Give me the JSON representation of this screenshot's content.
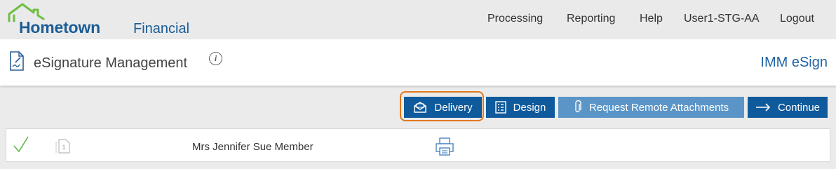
{
  "brand": {
    "name_part1": "Hometown",
    "name_part2": "Financial",
    "logo_color": "#1a5d96",
    "roof_color": "#6fbe44"
  },
  "nav": {
    "items": [
      "Processing",
      "Reporting",
      "Help",
      "User1-STG-AA",
      "Logout"
    ]
  },
  "title_bar": {
    "page_title": "eSignature Management",
    "info_icon": "i",
    "app_name": "IMM eSign"
  },
  "toolbar": {
    "buttons": [
      {
        "label": "Delivery",
        "icon": "envelope-icon",
        "focused": true
      },
      {
        "label": "Design",
        "icon": "list-icon"
      },
      {
        "label": "Request Remote Attachments",
        "icon": "paperclip-icon",
        "disabled_look": true
      },
      {
        "label": "Continue",
        "icon": "arrow-right-icon"
      }
    ],
    "accent": "#0f5a9c",
    "focus_color": "#e2781e"
  },
  "rows": [
    {
      "status": "check-icon",
      "document_count": "1",
      "name": "Mrs Jennifer Sue Member",
      "action": "printer-icon"
    }
  ]
}
